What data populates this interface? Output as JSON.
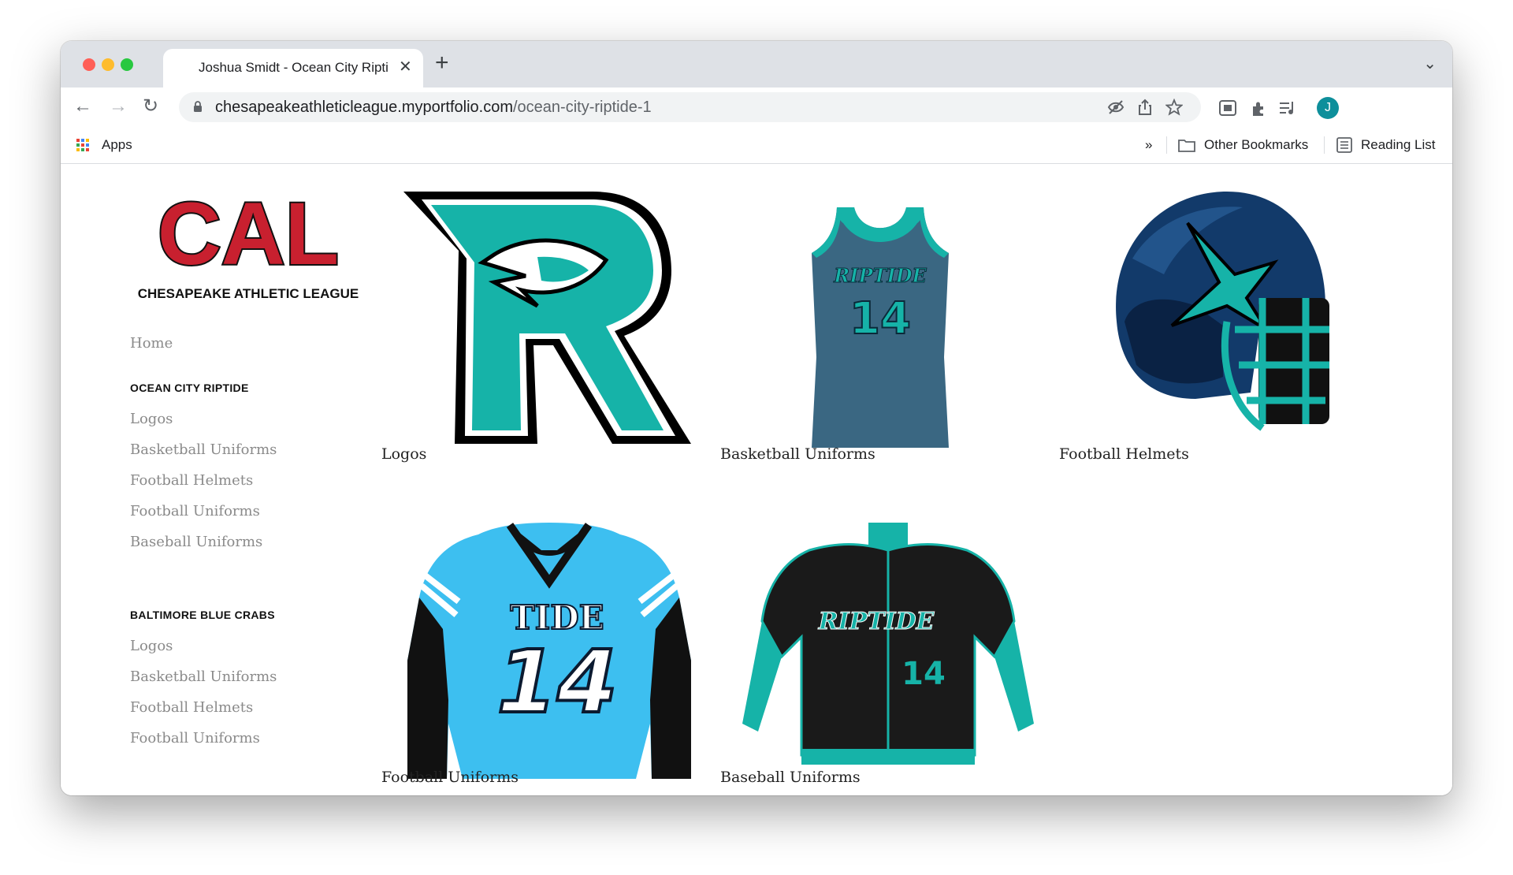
{
  "browser": {
    "tab_title": "Joshua Smidt - Ocean City Riptide",
    "new_tab_label": "+",
    "address": {
      "domain": "chesapeakeathleticleague.myportfolio.com",
      "path": "/ocean-city-riptide-1"
    },
    "avatar_initial": "J",
    "bookmarks": {
      "apps_label": "Apps",
      "overflow_label": "»",
      "other_label": "Other Bookmarks",
      "reading_list_label": "Reading List"
    }
  },
  "site": {
    "logo_text": "CAL",
    "logo_subtitle": "CHESAPEAKE ATHLETIC LEAGUE",
    "nav": {
      "home": "Home",
      "sections": [
        {
          "heading": "OCEAN CITY RIPTIDE",
          "links": [
            "Logos",
            "Basketball Uniforms",
            "Football Helmets",
            "Football Uniforms",
            "Baseball Uniforms"
          ]
        },
        {
          "heading": "BALTIMORE BLUE CRABS",
          "links": [
            "Logos",
            "Basketball Uniforms",
            "Football Helmets",
            "Football Uniforms"
          ]
        }
      ]
    },
    "projects": [
      {
        "title": "Logos"
      },
      {
        "title": "Basketball Uniforms",
        "jersey_text": "RIPTIDE",
        "number": "14"
      },
      {
        "title": "Football Helmets"
      },
      {
        "title": "Football Uniforms",
        "jersey_text": "TIDE",
        "number": "14"
      },
      {
        "title": "Baseball Uniforms",
        "jersey_text": "RIPTIDE",
        "number": "14"
      }
    ]
  },
  "colors": {
    "teal": "#16b3a8",
    "league_red": "#c8202f",
    "sky_blue": "#3dbff0",
    "navy": "#123a6a"
  }
}
